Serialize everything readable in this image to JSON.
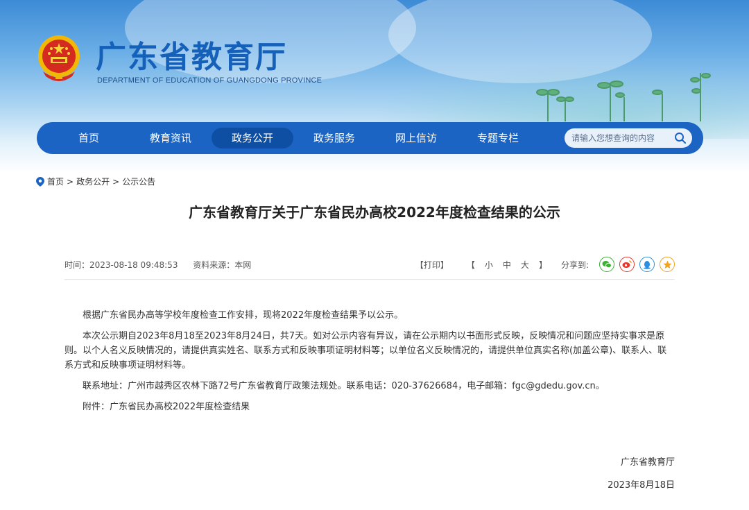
{
  "header": {
    "title": "广东省教育厅",
    "subtitle": "DEPARTMENT OF EDUCATION OF GUANGDONG PROVINCE"
  },
  "nav": {
    "items": [
      {
        "label": "首页"
      },
      {
        "label": "教育资讯"
      },
      {
        "label": "政务公开"
      },
      {
        "label": "政务服务"
      },
      {
        "label": "网上信访"
      },
      {
        "label": "专题专栏"
      }
    ],
    "active": "政务公开",
    "search_placeholder": "请输入您想查询的内容"
  },
  "breadcrumb": {
    "home": "首页",
    "sep1": ">",
    "level1": "政务公开",
    "sep2": ">",
    "level2": "公示公告"
  },
  "article": {
    "title": "广东省教育厅关于广东省民办高校2022年度检查结果的公示",
    "time": "时间：2023-08-18 09:48:53",
    "source": "资料来源：本网",
    "print": "【打印】",
    "font_open": "【",
    "font_small": "小",
    "font_medium": "中",
    "font_large": "大",
    "font_close": "】",
    "share_label": "分享到:",
    "paragraphs": [
      "根据广东省民办高等学校年度检查工作安排，现将2022年度检查结果予以公示。",
      "本次公示期自2023年8月18至2023年8月24日，共7天。如对公示内容有异议，请在公示期内以书面形式反映，反映情况和问题应坚持实事求是原则。以个人名义反映情况的，请提供真实姓名、联系方式和反映事项证明材料等；以单位名义反映情况的，请提供单位真实名称(加盖公章)、联系人、联系方式和反映事项证明材料等。",
      "联系地址：广州市越秀区农林下路72号广东省教育厅政策法规处。联系电话：020-37626684，电子邮箱：fgc@gdedu.gov.cn。",
      "附件：广东省民办高校2022年度检查结果"
    ],
    "signature": "广东省教育厅",
    "date": "2023年8月18日"
  },
  "colors": {
    "nav_bg": "#1b64c4",
    "nav_active": "#0f4fa3",
    "title_blue": "#1560b8"
  },
  "icons": {
    "share": [
      "wechat-icon",
      "weibo-icon",
      "qq-icon",
      "qzone-icon"
    ]
  }
}
